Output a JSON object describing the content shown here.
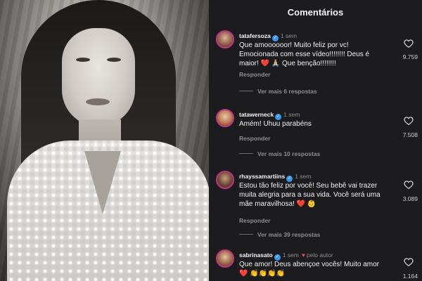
{
  "panel": {
    "title": "Comentários"
  },
  "comments": [
    {
      "username": "tatafersoza",
      "time": "1 sem",
      "text": "Que amoooooor! Muito feliz por vc! Emocionada com esse vídeo!!!!!!!! Deus é maior! ❤️ 🙏🏼 Que benção!!!!!!!!",
      "reply_label": "Responder",
      "more_replies": "Ver mais 6 respostas",
      "likes": "9.759"
    },
    {
      "username": "tatawerneck",
      "time": "1 sem",
      "text": "Amém! Uhuu parabéns",
      "reply_label": "Responder",
      "more_replies": "Ver mais 10 respostas",
      "likes": "7.508"
    },
    {
      "username": "rhayssamartiins",
      "time": "1 sem",
      "text": "Estou tão feliz por você! Seu bebê vai trazer muita alegria para a sua vida. Você será uma mãe maravilhosa! ❤️ 👶",
      "reply_label": "Responder",
      "more_replies": "Ver mais 39 respostas",
      "likes": "3.089"
    },
    {
      "username": "sabrinasato",
      "time": "1 sem",
      "author_tag": "pelo autor",
      "text": "Que amor! Deus abençoe vocês! Muito amor ❤️ 👏👏👏👏",
      "likes": "1.164"
    }
  ],
  "colors": {
    "background": "#1c1c1e",
    "verified": "#3897f0",
    "heart": "#ed4956"
  },
  "icons": [
    "verified-badge-icon",
    "heart-outline-icon",
    "heart-filled-icon"
  ]
}
